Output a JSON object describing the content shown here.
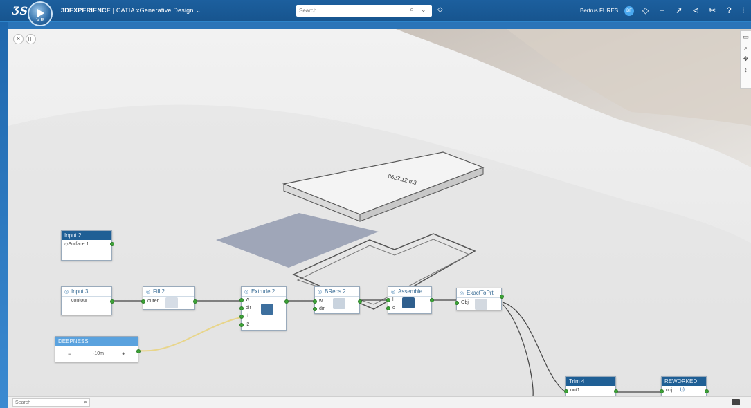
{
  "header": {
    "brand": "3DEXPERIENCE",
    "separator": " | ",
    "app": "CATIA xGenerative Design",
    "search_placeholder": "Search",
    "user_name": "Bertrus FURES",
    "user_initials": "BF",
    "icons": [
      "ds-logo-icon",
      "compass-icon",
      "search-icon",
      "chevron-down-icon",
      "tag-icon",
      "share-icon",
      "add-icon",
      "share-arrow-icon",
      "network-icon",
      "tools-icon",
      "help-icon"
    ]
  },
  "compass": {
    "version": "V.R"
  },
  "viewport": {
    "annotation": "8627.12 m3",
    "colors": {
      "terrain": "#e9e9e9",
      "shadow": "#8790a8",
      "wire": "#555555",
      "highlight_wire": "#e8d58a",
      "pin": "#3da437",
      "node_header": "#1f5f95"
    }
  },
  "nodes": {
    "input2": {
      "title": "Input 2",
      "output": "Surface.1"
    },
    "input3": {
      "title": "Input 3",
      "output": "contour"
    },
    "fill2": {
      "title": "Fill 2",
      "input": "outer"
    },
    "extrude2": {
      "title": "Extrude 2",
      "inputs": [
        "w",
        "dir",
        "d",
        "l2"
      ]
    },
    "breps2": {
      "title": "BReps 2",
      "inputs": [
        "w",
        "dir"
      ]
    },
    "assemble": {
      "title": "Assemble",
      "inputs": [
        "l",
        "c"
      ]
    },
    "exact": {
      "title": "ExactToPrt",
      "input": "Obj"
    },
    "trim4": {
      "title": "Trim 4",
      "input": "out1"
    },
    "reworked": {
      "title": "REWORKED",
      "input": "obj"
    },
    "deepness": {
      "title": "DEEPNESS",
      "value": "-10m",
      "minus": "−",
      "plus": "+"
    }
  },
  "statusbar": {
    "search_placeholder": "Search"
  }
}
